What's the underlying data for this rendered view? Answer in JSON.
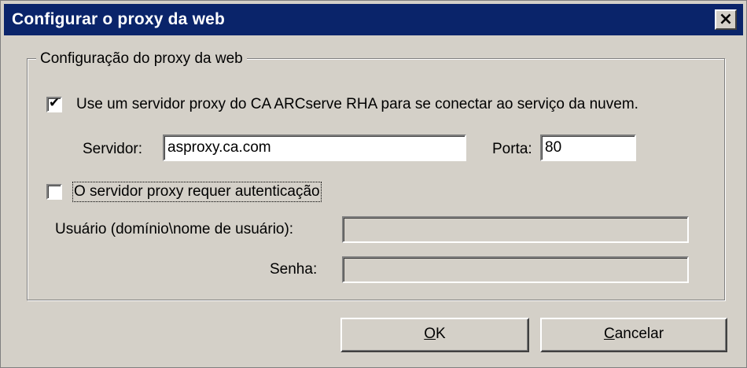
{
  "window": {
    "title": "Configurar o proxy da web",
    "close_symbol": "×"
  },
  "group": {
    "label": "Configuração do proxy da web"
  },
  "use_proxy": {
    "checked": true,
    "label": "Use um servidor proxy do CA ARCserve RHA para se conectar ao serviço da nuvem."
  },
  "server": {
    "label": "Servidor:",
    "value": "asproxy.ca.com"
  },
  "port": {
    "label": "Porta:",
    "value": "80"
  },
  "auth": {
    "checked": false,
    "label": "O servidor proxy requer autenticação"
  },
  "user": {
    "label": "Usuário (domínio\\nome de usuário):",
    "value": ""
  },
  "password": {
    "label": "Senha:",
    "value": ""
  },
  "buttons": {
    "ok": {
      "mnemonic": "O",
      "rest": "K"
    },
    "cancel": {
      "mnemonic": "C",
      "rest": "ancelar"
    }
  },
  "colors": {
    "titlebar": "#0a246a",
    "face": "#d4d0c8"
  }
}
